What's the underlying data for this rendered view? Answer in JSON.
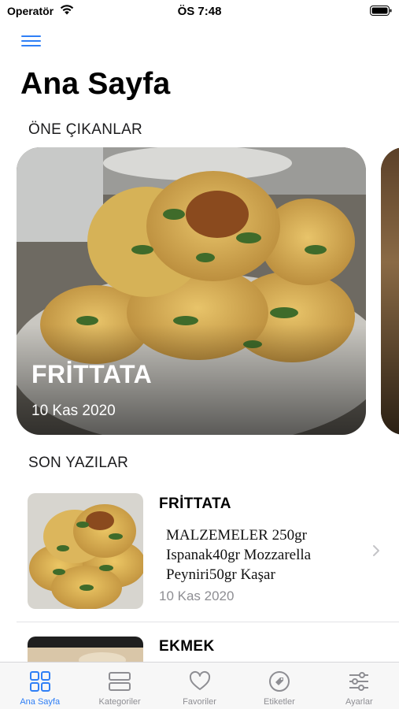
{
  "status_bar": {
    "carrier": "Operatör",
    "time": "ÖS 7:48"
  },
  "header": {
    "title": "Ana Sayfa"
  },
  "featured": {
    "section_title": "ÖNE ÇIKANLAR",
    "cards": [
      {
        "name": "FRİTTATA",
        "date": "10 Kas 2020"
      }
    ]
  },
  "recent": {
    "section_title": "SON YAZILAR",
    "posts": [
      {
        "name": "FRİTTATA",
        "excerpt": "MALZEMELER 250gr Ispanak40gr Mozzarella Peyniri50gr Kaşar",
        "date": "10 Kas 2020"
      },
      {
        "name": "EKMEK"
      }
    ]
  },
  "tab_bar": {
    "active": "Ana Sayfa",
    "tabs": [
      {
        "label": "Ana Sayfa",
        "icon": "grid-icon"
      },
      {
        "label": "Kategoriler",
        "icon": "stack-icon"
      },
      {
        "label": "Favoriler",
        "icon": "heart-icon"
      },
      {
        "label": "Etiketler",
        "icon": "tag-icon"
      },
      {
        "label": "Ayarlar",
        "icon": "sliders-icon"
      }
    ]
  },
  "colors": {
    "accent": "#2f7ff6",
    "inactive": "#8e8e93"
  }
}
